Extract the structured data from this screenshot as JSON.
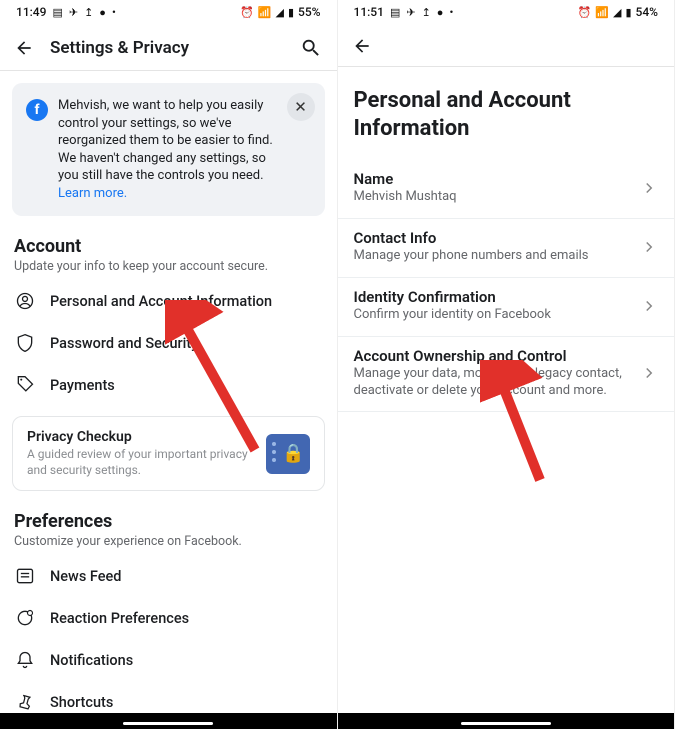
{
  "left": {
    "status": {
      "time": "11:49",
      "battery": "55%"
    },
    "header": {
      "title": "Settings & Privacy"
    },
    "banner": {
      "text": "Mehvish, we want to help you easily control your settings, so we've reorganized them to be easier to find. We haven't changed any settings, so you still have the controls you need. ",
      "link": "Learn more."
    },
    "account": {
      "title": "Account",
      "sub": "Update your info to keep your account secure.",
      "items": [
        "Personal and Account Information",
        "Password and Security",
        "Payments"
      ]
    },
    "privacyCard": {
      "title": "Privacy Checkup",
      "sub": "A guided review of your important privacy and security settings."
    },
    "prefs": {
      "title": "Preferences",
      "sub": "Customize your experience on Facebook.",
      "items": [
        "News Feed",
        "Reaction Preferences",
        "Notifications",
        "Shortcuts"
      ]
    }
  },
  "right": {
    "status": {
      "time": "11:51",
      "battery": "54%"
    },
    "page_title": "Personal and Account Information",
    "items": [
      {
        "title": "Name",
        "sub": "Mehvish Mushtaq"
      },
      {
        "title": "Contact Info",
        "sub": "Manage your phone numbers and emails"
      },
      {
        "title": "Identity Confirmation",
        "sub": "Confirm your identity on Facebook"
      },
      {
        "title": "Account Ownership and Control",
        "sub": "Manage your data, modify your legacy contact, deactivate or delete your account and more."
      }
    ]
  }
}
